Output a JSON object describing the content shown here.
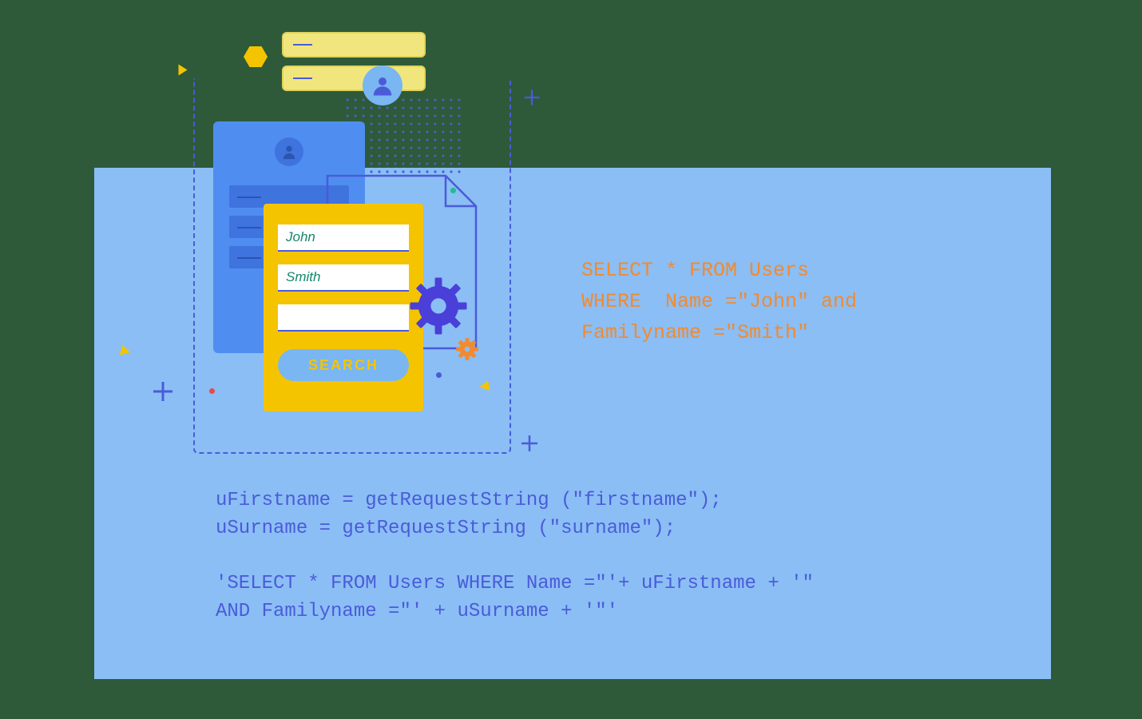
{
  "form": {
    "input1_value": "John",
    "input2_value": "Smith",
    "input3_value": "",
    "search_button_label": "SEARCH"
  },
  "sql_query": {
    "line1": "SELECT * FROM Users",
    "line2": "WHERE  Name =\"John\" and",
    "line3": "Familyname =\"Smith\""
  },
  "code": {
    "line1": "uFirstname = getRequestString (\"firstname\");",
    "line2": "uSurname = getRequestString (\"surname\");",
    "line3": "",
    "line4": "'SELECT * FROM Users WHERE Name =\"'+ uFirstname + '\"",
    "line5": "AND Familyname =\"' + uSurname + '\"'"
  }
}
